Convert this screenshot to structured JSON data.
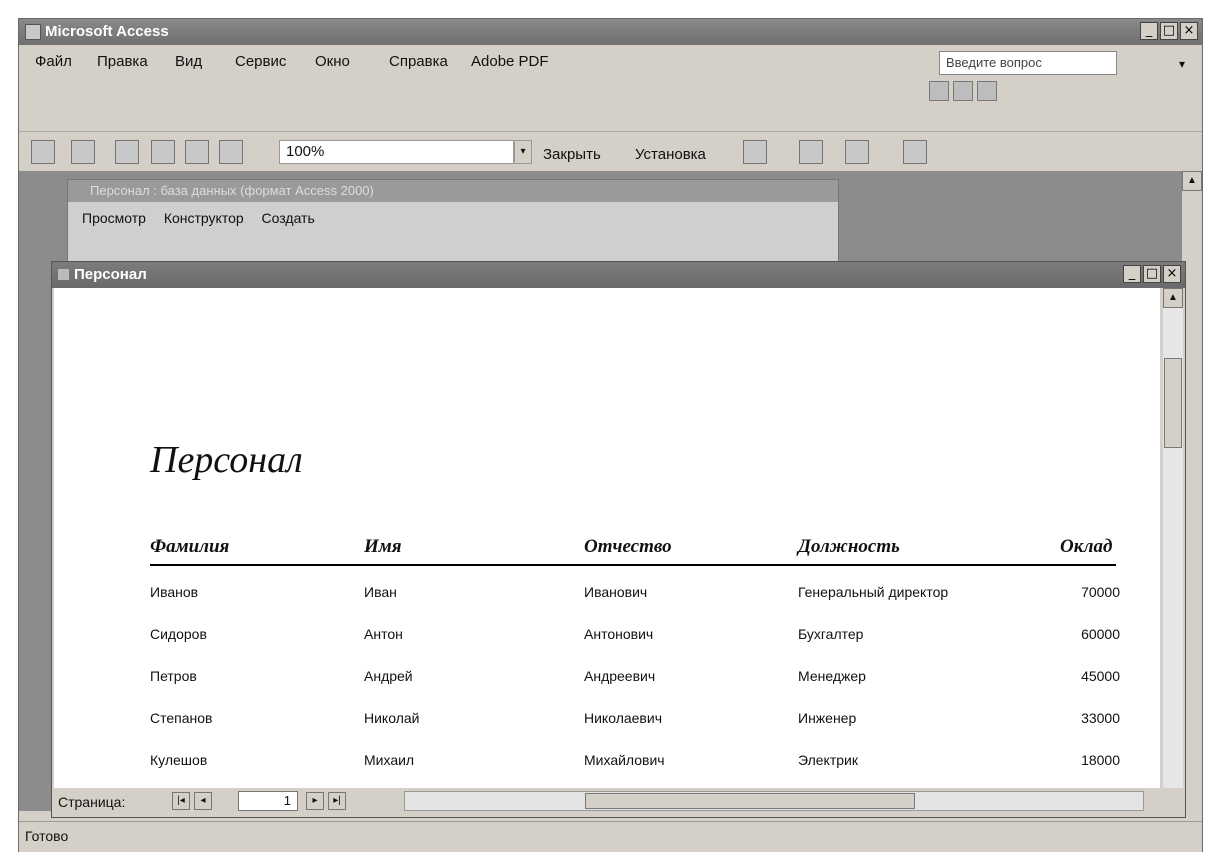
{
  "app": {
    "title": "Microsoft Access"
  },
  "window_buttons": {
    "minimize": "_",
    "maximize": "□",
    "close": "×"
  },
  "menu": {
    "items": [
      "Файл",
      "Правка",
      "Вид",
      "Сервис",
      "Окно",
      "Справка",
      "Adobe PDF"
    ],
    "ask_placeholder": "Введите вопрос",
    "ask_drop": "▾"
  },
  "toolbar": {
    "zoom": "100%",
    "zoom_drop": "▾",
    "close_label": "Закрыть",
    "setup_label": "Установка"
  },
  "db_window": {
    "title": "Персонал : база данных (формат Access 2000)",
    "buttons": [
      "Просмотр",
      "Конструктор",
      "Создать"
    ]
  },
  "report": {
    "window_title": "Персонал",
    "heading": "Персонал",
    "columns": [
      "Фамилия",
      "Имя",
      "Отчество",
      "Должность",
      "Оклад"
    ],
    "rows": [
      [
        "Иванов",
        "Иван",
        "Иванович",
        "Генеральный директор",
        "70000"
      ],
      [
        "Сидоров",
        "Антон",
        "Антонович",
        "Бухгалтер",
        "60000"
      ],
      [
        "Петров",
        "Андрей",
        "Андреевич",
        "Менеджер",
        "45000"
      ],
      [
        "Степанов",
        "Николай",
        "Николаевич",
        "Инженер",
        "33000"
      ],
      [
        "Кулешов",
        "Михаил",
        "Михайлович",
        "Электрик",
        "18000"
      ]
    ]
  },
  "navigation": {
    "label": "Страница:",
    "page": "1",
    "first": "|◂",
    "prev": "◂",
    "next": "▸",
    "last": "▸|"
  },
  "status": {
    "text": "Готово"
  }
}
